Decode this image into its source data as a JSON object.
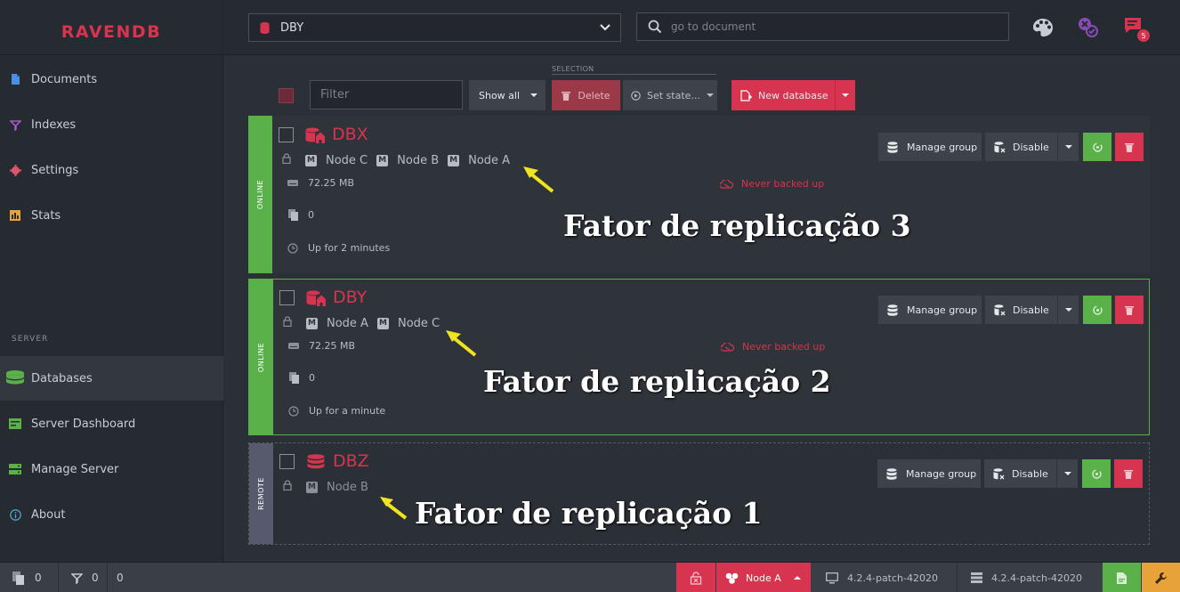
{
  "app": {
    "logo": "RAVENDB"
  },
  "sidebar": {
    "items": [
      {
        "label": "Documents",
        "icon": "document-icon"
      },
      {
        "label": "Indexes",
        "icon": "index-funnel-icon"
      },
      {
        "label": "Settings",
        "icon": "gear-icon"
      },
      {
        "label": "Stats",
        "icon": "stats-icon"
      }
    ],
    "section_label": "SERVER",
    "server_items": [
      {
        "label": "Databases",
        "icon": "database-icon",
        "active": true
      },
      {
        "label": "Server Dashboard",
        "icon": "dashboard-icon"
      },
      {
        "label": "Manage Server",
        "icon": "manage-server-icon"
      },
      {
        "label": "About",
        "icon": "info-icon"
      }
    ]
  },
  "topbar": {
    "db_selected": "DBY",
    "search_placeholder": "go to document",
    "notification_count": "5"
  },
  "toolbar": {
    "filter_placeholder": "Filter",
    "show_all": "Show all",
    "selection_label": "SELECTION",
    "delete": "Delete",
    "set_state": "Set state...",
    "new_database": "New database"
  },
  "databases": [
    {
      "name": "DBX",
      "status": "ONLINE",
      "nodes": [
        "Node C",
        "Node B",
        "Node A"
      ],
      "size": "72.25 MB",
      "docs": "0",
      "uptime": "Up for 2 minutes",
      "backup": "Never backed up"
    },
    {
      "name": "DBY",
      "status": "ONLINE",
      "nodes": [
        "Node A",
        "Node C"
      ],
      "size": "72.25 MB",
      "docs": "0",
      "uptime": "Up for a minute",
      "backup": "Never backed up"
    },
    {
      "name": "DBZ",
      "status": "REMOTE",
      "nodes": [
        "Node B"
      ]
    }
  ],
  "card_buttons": {
    "manage_group": "Manage group",
    "disable": "Disable"
  },
  "annotations": [
    "Fator de replicação 3",
    "Fator de replicação 2",
    "Fator de replicação 1"
  ],
  "footer": {
    "docs_count": "0",
    "indexes_count": "0",
    "errors_count": "0",
    "node": "Node A",
    "client_version": "4.2.4-patch-42020",
    "server_version": "4.2.4-patch-42020"
  },
  "colors": {
    "accent": "#d6344f",
    "online": "#5ab14a",
    "remote": "#555a6c",
    "sidebar": "#262a31",
    "background": "#2b2f36"
  }
}
